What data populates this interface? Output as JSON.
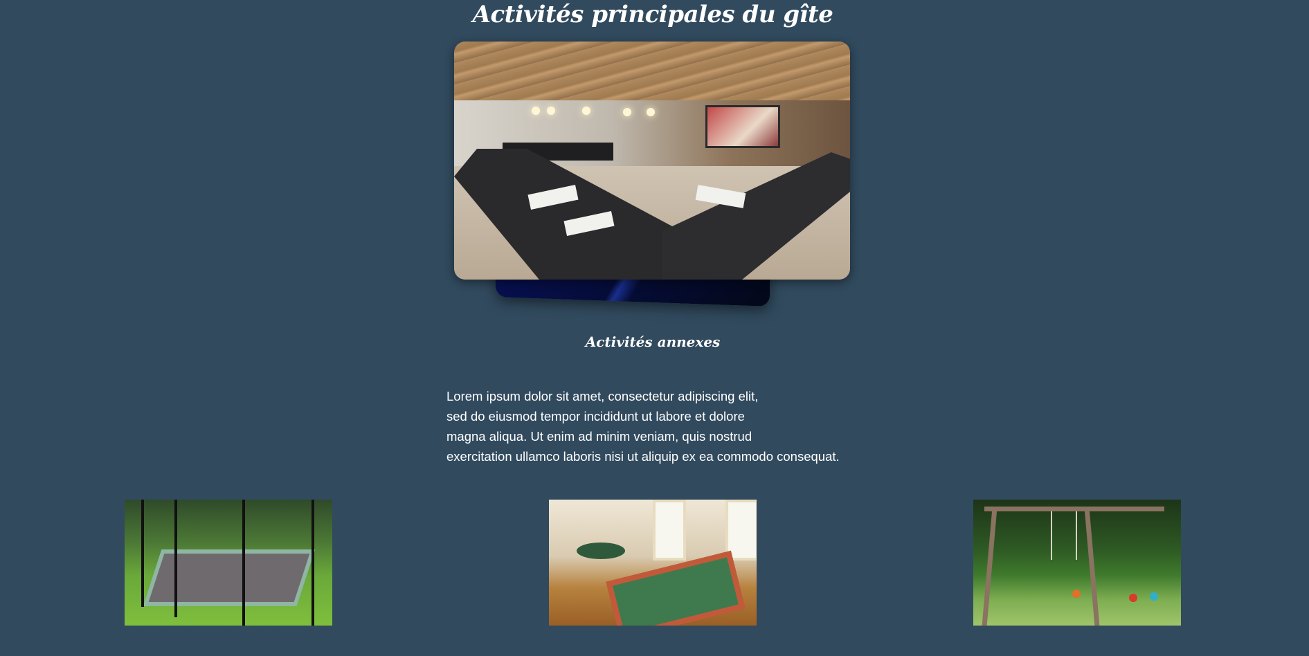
{
  "page": {
    "title": "Activités principales du gîte",
    "subtitle": "Activités annexes",
    "paragraph_lines": [
      "Lorem ipsum dolor sit amet, consectetur adipiscing elit,",
      "sed do eiusmod tempor incididunt ut labore et dolore",
      "magna aliqua. Ut enim ad minim veniam, quis nostrud",
      "exercitation ullamco laboris nisi ut aliquip ex ea commodo consequat."
    ]
  },
  "colors": {
    "background": "#314a5e",
    "text": "#ffffff"
  },
  "carousel": {
    "cards": [
      {
        "image": "conference-room-photo"
      },
      {
        "image": "blue-abstract-photo"
      },
      {
        "image": "wooden-interior-photo"
      }
    ]
  },
  "thumbnails": [
    {
      "image": "trampoline-photo"
    },
    {
      "image": "game-room-foosball-photo"
    },
    {
      "image": "garden-swing-photo"
    }
  ]
}
